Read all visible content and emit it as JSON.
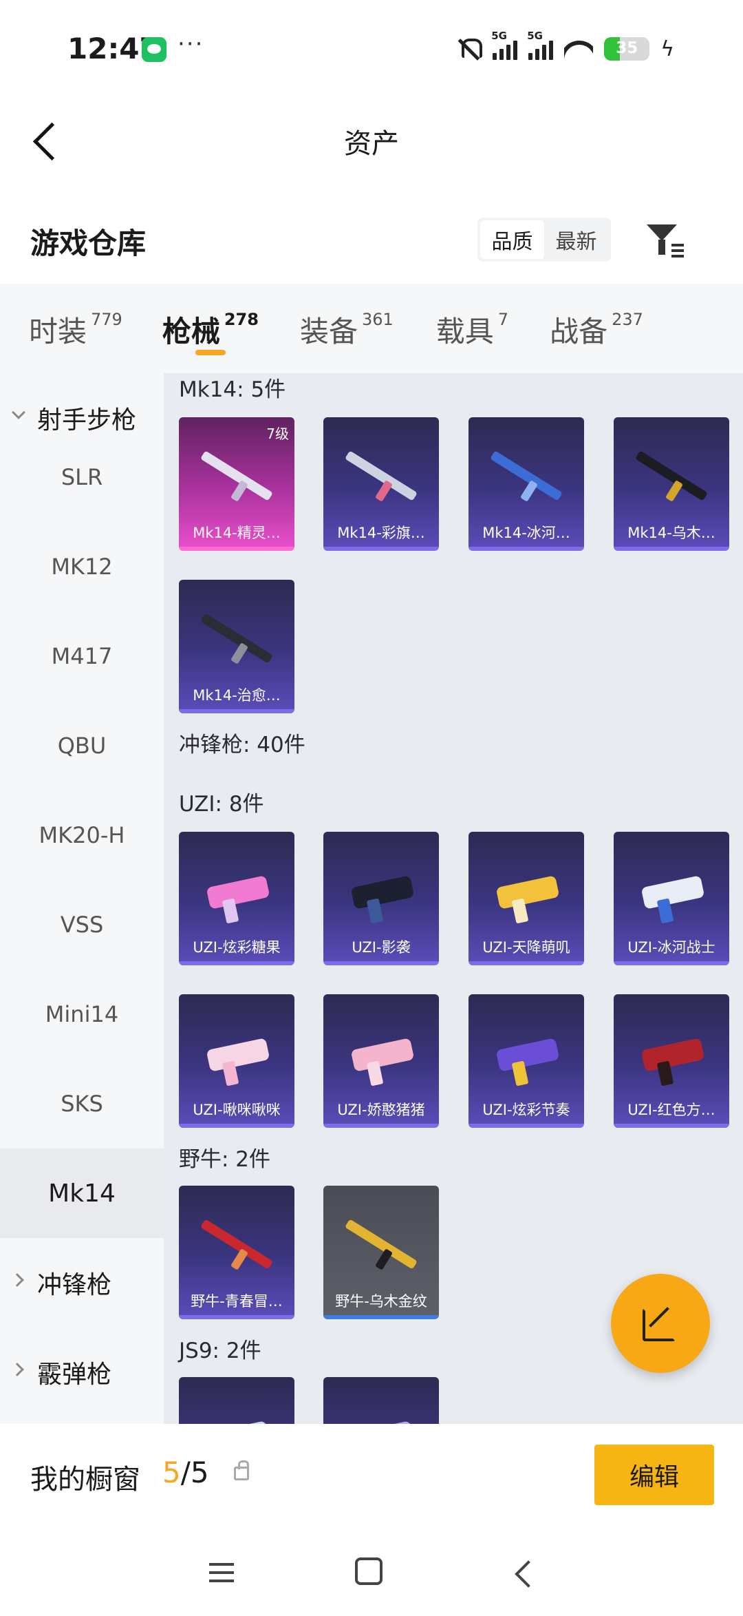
{
  "status_bar": {
    "time": "12:47",
    "network_1": "5G",
    "network_2": "5G",
    "battery": "35",
    "battery_level": 0.35,
    "colors": {
      "battery_fill": "#2fc23a",
      "wechat": "#1ec15f"
    }
  },
  "header": {
    "title": "资产"
  },
  "warehouse": {
    "label": "游戏仓库",
    "sort_options": [
      "品质",
      "最新"
    ],
    "sort_selected": "品质"
  },
  "tabs": [
    {
      "label": "时装",
      "count": "779"
    },
    {
      "label": "枪械",
      "count": "278",
      "active": true
    },
    {
      "label": "装备",
      "count": "361"
    },
    {
      "label": "载具",
      "count": "7"
    },
    {
      "label": "战备",
      "count": "237"
    }
  ],
  "sidebar": {
    "group_1": "射手步枪",
    "items": [
      "SLR",
      "MK12",
      "M417",
      "QBU",
      "MK20-H",
      "VSS",
      "Mini14",
      "SKS",
      "Mk14"
    ],
    "active_item": "Mk14",
    "group_2": "冲锋枪",
    "group_3": "霰弹枪"
  },
  "sections": {
    "mk14_header": "Mk14: 5件",
    "smg_header": "冲锋枪: 40件",
    "uzi_header": "UZI: 8件",
    "bison_header": "野牛: 2件",
    "js9_header": "JS9: 2件"
  },
  "items": {
    "mk14": [
      {
        "name": "Mk14-精灵…",
        "badge": "7级",
        "tier": "pink"
      },
      {
        "name": "Mk14-彩旗…",
        "tier": "purple"
      },
      {
        "name": "Mk14-冰河…",
        "tier": "purple"
      },
      {
        "name": "Mk14-乌木…",
        "tier": "purple"
      },
      {
        "name": "Mk14-治愈…",
        "tier": "purple"
      }
    ],
    "uzi": [
      {
        "name": "UZI-炫彩糖果"
      },
      {
        "name": "UZI-影袭"
      },
      {
        "name": "UZI-天降萌叽"
      },
      {
        "name": "UZI-冰河战士"
      },
      {
        "name": "UZI-啾咪啾咪"
      },
      {
        "name": "UZI-娇憨猪猪"
      },
      {
        "name": "UZI-炫彩节奏"
      },
      {
        "name": "UZI-红色方…"
      }
    ],
    "bison": [
      {
        "name": "野牛-青春冒…",
        "tier": "purple"
      },
      {
        "name": "野牛-乌木金纹",
        "tier": "grey"
      }
    ],
    "js9": [
      {},
      {}
    ]
  },
  "showcase": {
    "label": "我的橱窗",
    "current": "5",
    "total": "/5",
    "edit_label": "编辑"
  },
  "colors": {
    "accent": "#f5a623",
    "card_purple": "#3b3580",
    "card_pink": "#a9329e",
    "card_grey": "#5d5f69"
  }
}
